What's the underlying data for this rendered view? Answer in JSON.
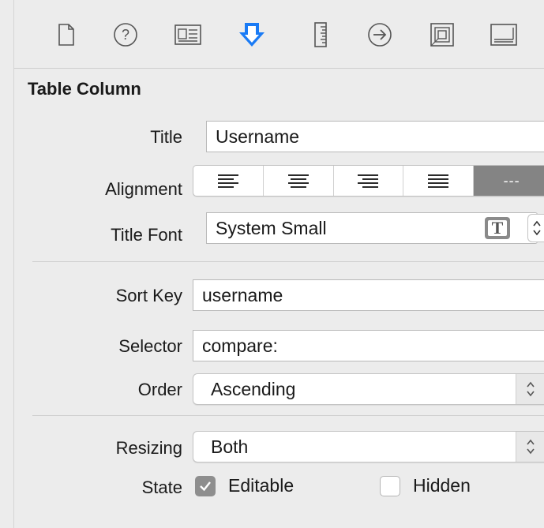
{
  "toolbar": {
    "icons": [
      {
        "name": "file-inspector-icon",
        "active": false
      },
      {
        "name": "quick-help-icon",
        "active": false
      },
      {
        "name": "identity-inspector-icon",
        "active": false
      },
      {
        "name": "attributes-inspector-icon",
        "active": true
      },
      {
        "name": "size-inspector-icon",
        "active": false
      },
      {
        "name": "connections-inspector-icon",
        "active": false
      },
      {
        "name": "bindings-inspector-icon",
        "active": false
      },
      {
        "name": "view-effects-inspector-icon",
        "active": false
      }
    ],
    "accent_color": "#1a7bf5"
  },
  "section": {
    "title": "Table Column"
  },
  "fields": {
    "title": {
      "label": "Title",
      "value": "Username"
    },
    "alignment": {
      "label": "Alignment",
      "options": [
        "left",
        "center",
        "right",
        "justified",
        "natural"
      ],
      "selected": "natural",
      "selected_glyph": "---"
    },
    "title_font": {
      "label": "Title Font",
      "value": "System Small"
    },
    "sort_key": {
      "label": "Sort Key",
      "value": "username"
    },
    "selector": {
      "label": "Selector",
      "value": "compare:"
    },
    "order": {
      "label": "Order",
      "value": "Ascending"
    },
    "resizing": {
      "label": "Resizing",
      "value": "Both"
    },
    "state": {
      "label": "State",
      "editable": {
        "label": "Editable",
        "checked": true
      },
      "hidden": {
        "label": "Hidden",
        "checked": false
      }
    }
  }
}
